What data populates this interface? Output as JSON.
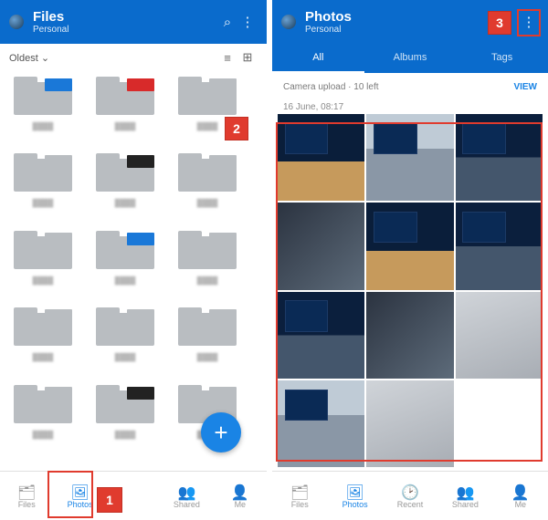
{
  "left": {
    "title": "Files",
    "subtitle": "Personal",
    "sort": "Oldest",
    "folders": [
      {
        "tab": "#1a78d8"
      },
      {
        "tab": "#d82a2a"
      },
      {
        "tab": "#b9bdc1"
      },
      {
        "tab": "#b9bdc1"
      },
      {
        "tab": "#222"
      },
      {
        "tab": "#b9bdc1"
      },
      {
        "tab": "#b9bdc1"
      },
      {
        "tab": "#1a78d8"
      },
      {
        "tab": "#b9bdc1"
      },
      {
        "tab": "#b9bdc1"
      },
      {
        "tab": "#b9bdc1"
      },
      {
        "tab": "#b9bdc1"
      },
      {
        "tab": "#b9bdc1"
      },
      {
        "tab": "#222"
      },
      {
        "tab": "#b9bdc1"
      }
    ],
    "bottom": [
      "Files",
      "Photos",
      "",
      "Shared",
      "Me"
    ]
  },
  "right": {
    "title": "Photos",
    "subtitle": "Personal",
    "tabs": [
      "All",
      "Albums",
      "Tags"
    ],
    "upload_text": "Camera upload · 10 left",
    "upload_action": "VIEW",
    "date": "16 June, 08:17",
    "bottom": [
      "Files",
      "Photos",
      "Recent",
      "Shared",
      "Me"
    ]
  },
  "callouts": {
    "1": "1",
    "2": "2",
    "3": "3"
  }
}
